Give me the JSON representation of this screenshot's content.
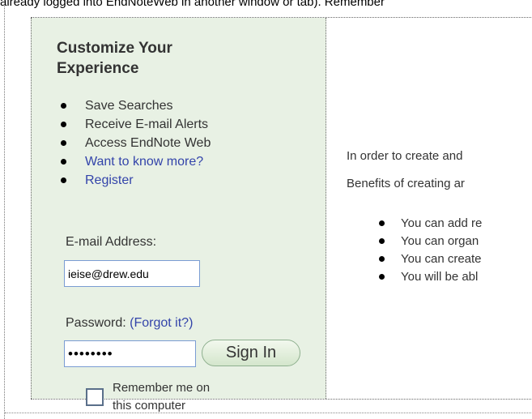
{
  "header": {
    "top_text": "already logged into EndNoteWeb in another window or tab). Remember"
  },
  "panel": {
    "title": "Customize Your Experience",
    "benefits": [
      {
        "label": "Save Searches",
        "link": false
      },
      {
        "label": "Receive E-mail Alerts",
        "link": false
      },
      {
        "label": "Access EndNote Web",
        "link": false
      },
      {
        "label": "Want to know more?",
        "link": true
      },
      {
        "label": "Register",
        "link": true
      }
    ],
    "email_label": "E-mail Address:",
    "email_value": "ieise@drew.edu",
    "password_label": "Password:",
    "forgot_text": "(Forgot it?)",
    "password_value": "••••••••",
    "signin_label": "Sign In",
    "remember_line1": "Remember me on",
    "remember_line2": "this computer",
    "remember_checked": false
  },
  "main": {
    "intro_line1": "In order to create and",
    "intro_line2": "Benefits of creating ar",
    "bullets": [
      "You can add re",
      "You can organ",
      "You can create",
      "You will be abl"
    ]
  },
  "colors": {
    "panel_bg": "#e8f1e4",
    "link": "#3344aa",
    "input_border": "#7a9cd3"
  }
}
